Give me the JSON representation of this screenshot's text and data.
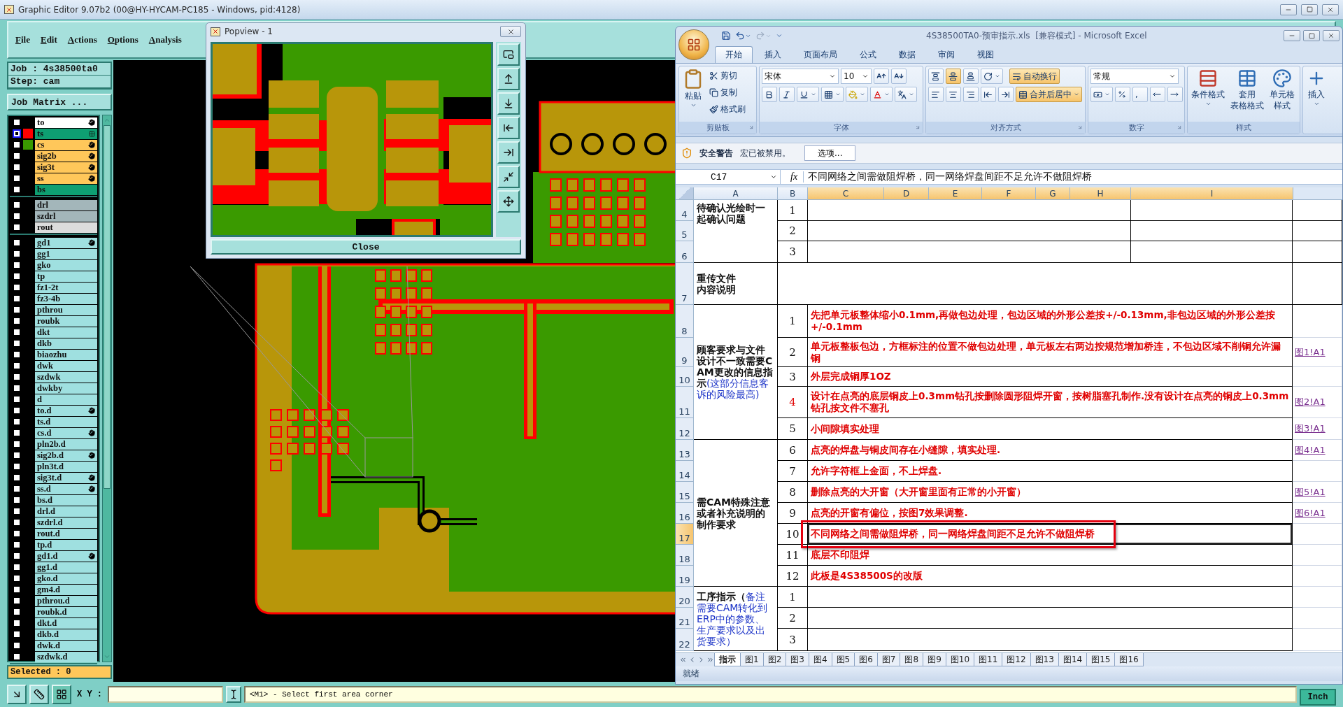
{
  "editor": {
    "title": "Graphic Editor 9.07b2 (00@HY-HYCAM-PC185 - Windows, pid:4128)",
    "menu": [
      "File",
      "Edit",
      "Actions",
      "Options",
      "Analysis"
    ],
    "job": "Job : 4s38500ta0",
    "step": "Step: cam",
    "job_matrix": "Job Matrix ...",
    "layer_groups": [
      {
        "layers": [
          {
            "name": "to",
            "kind": "overlay",
            "selected": false,
            "marker": true
          },
          {
            "name": "ts",
            "kind": "mask",
            "selected": true,
            "marker": false,
            "color": "#ff0000"
          },
          {
            "name": "cs",
            "kind": "signal",
            "selected": false,
            "marker": true,
            "color": "#3a9a00"
          },
          {
            "name": "sig2b",
            "kind": "signal",
            "selected": false,
            "marker": true
          },
          {
            "name": "sig3t",
            "kind": "signal",
            "selected": false,
            "marker": true
          },
          {
            "name": "ss",
            "kind": "signal",
            "selected": false,
            "marker": true
          },
          {
            "name": "bs",
            "kind": "mask",
            "selected": false,
            "marker": false
          }
        ]
      },
      {
        "layers": [
          {
            "name": "drl",
            "kind": "drill",
            "selected": false,
            "marker": false
          },
          {
            "name": "szdrl",
            "kind": "drill",
            "selected": false,
            "marker": false
          },
          {
            "name": "rout",
            "kind": "rout",
            "selected": false,
            "marker": false
          }
        ]
      },
      {
        "layers": [
          {
            "name": "gd1",
            "kind": "document",
            "selected": false,
            "marker": true
          },
          {
            "name": "gg1",
            "kind": "document",
            "selected": false,
            "marker": false
          },
          {
            "name": "gko",
            "kind": "document",
            "selected": false,
            "marker": false
          },
          {
            "name": "tp",
            "kind": "document",
            "selected": false,
            "marker": false
          },
          {
            "name": "fz1-2t",
            "kind": "document",
            "selected": false,
            "marker": false
          },
          {
            "name": "fz3-4b",
            "kind": "document",
            "selected": false,
            "marker": false
          },
          {
            "name": "pthrou",
            "kind": "document",
            "selected": false,
            "marker": false
          },
          {
            "name": "roubk",
            "kind": "document",
            "selected": false,
            "marker": false
          },
          {
            "name": "dkt",
            "kind": "document",
            "selected": false,
            "marker": false
          },
          {
            "name": "dkb",
            "kind": "document",
            "selected": false,
            "marker": false
          },
          {
            "name": "biaozhu",
            "kind": "document",
            "selected": false,
            "marker": false
          },
          {
            "name": "dwk",
            "kind": "document",
            "selected": false,
            "marker": false
          },
          {
            "name": "szdwk",
            "kind": "document",
            "selected": false,
            "marker": false
          },
          {
            "name": "dwkby",
            "kind": "document",
            "selected": false,
            "marker": false
          },
          {
            "name": "d",
            "kind": "document",
            "selected": false,
            "marker": false
          },
          {
            "name": "to.d",
            "kind": "document",
            "selected": false,
            "marker": true
          },
          {
            "name": "ts.d",
            "kind": "document",
            "selected": false,
            "marker": false
          },
          {
            "name": "cs.d",
            "kind": "document",
            "selected": false,
            "marker": true
          },
          {
            "name": "pln2b.d",
            "kind": "document",
            "selected": false,
            "marker": false
          },
          {
            "name": "sig2b.d",
            "kind": "document",
            "selected": false,
            "marker": true
          },
          {
            "name": "pln3t.d",
            "kind": "document",
            "selected": false,
            "marker": false
          },
          {
            "name": "sig3t.d",
            "kind": "document",
            "selected": false,
            "marker": true
          },
          {
            "name": "ss.d",
            "kind": "document",
            "selected": false,
            "marker": true
          },
          {
            "name": "bs.d",
            "kind": "document",
            "selected": false,
            "marker": false
          },
          {
            "name": "drl.d",
            "kind": "document",
            "selected": false,
            "marker": false
          },
          {
            "name": "szdrl.d",
            "kind": "document",
            "selected": false,
            "marker": false
          },
          {
            "name": "rout.d",
            "kind": "document",
            "selected": false,
            "marker": false
          },
          {
            "name": "tp.d",
            "kind": "document",
            "selected": false,
            "marker": false
          },
          {
            "name": "gd1.d",
            "kind": "document",
            "selected": false,
            "marker": true
          },
          {
            "name": "gg1.d",
            "kind": "document",
            "selected": false,
            "marker": false
          },
          {
            "name": "gko.d",
            "kind": "document",
            "selected": false,
            "marker": false
          },
          {
            "name": "gm4.d",
            "kind": "document",
            "selected": false,
            "marker": false
          },
          {
            "name": "pthrou.d",
            "kind": "document",
            "selected": false,
            "marker": false
          },
          {
            "name": "roubk.d",
            "kind": "document",
            "selected": false,
            "marker": false
          },
          {
            "name": "dkt.d",
            "kind": "document",
            "selected": false,
            "marker": false
          },
          {
            "name": "dkb.d",
            "kind": "document",
            "selected": false,
            "marker": false
          },
          {
            "name": "dwk.d",
            "kind": "document",
            "selected": false,
            "marker": false
          },
          {
            "name": "szdwk.d",
            "kind": "document",
            "selected": false,
            "marker": false
          }
        ]
      }
    ],
    "selected_count": "Selected : 0",
    "xy_label": "X Y :",
    "prompt": "<M1> - Select first area corner",
    "units": "Inch"
  },
  "popview": {
    "title": "Popview - 1",
    "close": "Close"
  },
  "excel": {
    "title": "4S38500TA0-预审指示.xls  [兼容模式] - Microsoft Excel",
    "tabs": [
      {
        "label": "开始",
        "selected": true
      },
      {
        "label": "插入",
        "selected": false
      },
      {
        "label": "页面布局",
        "selected": false
      },
      {
        "label": "公式",
        "selected": false
      },
      {
        "label": "数据",
        "selected": false
      },
      {
        "label": "审阅",
        "selected": false
      },
      {
        "label": "视图",
        "selected": false
      }
    ],
    "clipboard": {
      "paste": "粘贴",
      "cut": "剪切",
      "copy": "复制",
      "painter": "格式刷",
      "label": "剪贴板"
    },
    "font": {
      "name": "宋体",
      "size": "10",
      "label": "字体"
    },
    "alignment": {
      "valign": [
        {
          "selected": false
        },
        {
          "selected": true
        },
        {
          "selected": false
        }
      ],
      "wrap": "自动换行",
      "wrap_on": true,
      "merge": "合并后居中",
      "merge_on": true,
      "label": "对齐方式"
    },
    "number": {
      "format": "常规",
      "comma": ",",
      "label": "数字"
    },
    "styles": {
      "conditional": "条件格式",
      "table": [
        "套用",
        "表格格式"
      ],
      "cell": [
        "单元格",
        "样式"
      ],
      "label": "样式"
    },
    "cells": {
      "insert": "插入"
    },
    "security": {
      "title": "安全警告",
      "message": "宏已被禁用。",
      "button": "选项..."
    },
    "formula": {
      "cell": "C17",
      "fx": "fx",
      "content": "不同网络之间需做阻焊桥，同一网络焊盘间距不足允许不做阻焊桥"
    },
    "columns": [
      {
        "label": "A",
        "selected": false
      },
      {
        "label": "B",
        "selected": false
      },
      {
        "label": "C",
        "selected": true
      },
      {
        "label": "D",
        "selected": true
      },
      {
        "label": "E",
        "selected": true
      },
      {
        "label": "F",
        "selected": true
      },
      {
        "label": "G",
        "selected": true
      },
      {
        "label": "H",
        "selected": true
      },
      {
        "label": "I",
        "selected": true
      }
    ],
    "sections": [
      {
        "label": "待确认光绘时一起确认问题",
        "kind": "pending",
        "rows": [
          {
            "row": "4",
            "num": "1",
            "selected": false,
            "marked": false,
            "emphasis": false
          },
          {
            "row": "5",
            "num": "2",
            "selected": false,
            "marked": false,
            "emphasis": false
          },
          {
            "row": "6",
            "num": "3",
            "selected": false,
            "marked": false,
            "emphasis": false
          }
        ]
      },
      {
        "lines": [
          "重传文件",
          "内容说明"
        ],
        "kind": "note",
        "rows": [
          {
            "row": "7",
            "selected": false,
            "marked": false
          }
        ]
      },
      {
        "label": "顾客要求与文件设计不一致需要CAM更改的信息指示",
        "note": "(这部分信息客诉的风险最高)",
        "kind": "list",
        "rows": [
          {
            "row": "8",
            "num": "1",
            "text": "先把单元板整体缩小0.1mm,再做包边处理，包边区域的外形公差按+/-0.13mm,非包边区域的外形公差按+/-0.1mm",
            "selected": false,
            "marked": false,
            "emphasis": false
          },
          {
            "row": "9",
            "num": "2",
            "text": "单元板整板包边，方框标注的位置不做包边处理，单元板左右两边按规范增加桥连，不包边区域不削铜允许漏铜",
            "link": "图1!A1",
            "selected": false,
            "marked": false,
            "emphasis": false
          },
          {
            "row": "10",
            "num": "3",
            "text": "外层完成铜厚1OZ",
            "selected": false,
            "marked": false,
            "emphasis": false
          },
          {
            "row": "11",
            "num": "4",
            "text": "设计在点亮的底层铜皮上0.3mm钻孔按删除圆形阻焊开窗，按树脂塞孔制作.没有设计在点亮的铜皮上0.3mm钻孔按文件不塞孔",
            "link": "图2!A1",
            "selected": false,
            "marked": false,
            "emphasis": true
          },
          {
            "row": "12",
            "num": "5",
            "text": "小间隙填实处理",
            "link": "图3!A1",
            "selected": false,
            "marked": false,
            "emphasis": false
          }
        ]
      },
      {
        "label": "需CAM特殊注意或者补充说明的制作要求",
        "kind": "list",
        "rows": [
          {
            "row": "13",
            "num": "6",
            "text": "点亮的焊盘与铜皮间存在小缝隙，填实处理.",
            "link": "图4!A1",
            "selected": false,
            "marked": false,
            "emphasis": false
          },
          {
            "row": "14",
            "num": "7",
            "text": "允许字符框上金面，不上焊盘.",
            "selected": false,
            "marked": false,
            "emphasis": false
          },
          {
            "row": "15",
            "num": "8",
            "text": "删除点亮的大开窗（大开窗里面有正常的小开窗）",
            "link": "图5!A1",
            "selected": false,
            "marked": false,
            "emphasis": false
          },
          {
            "row": "16",
            "num": "9",
            "text": "点亮的开窗有偏位，按图7效果调整.",
            "link": "图6!A1",
            "selected": false,
            "marked": false,
            "emphasis": false
          },
          {
            "row": "17",
            "num": "10",
            "text": "不同网络之间需做阻焊桥，同一网络焊盘间距不足允许不做阻焊桥",
            "selected": true,
            "marked": true,
            "emphasis": false
          },
          {
            "row": "18",
            "num": "11",
            "text": "底层不印阻焊",
            "selected": false,
            "marked": false,
            "emphasis": false
          },
          {
            "row": "19",
            "num": "12",
            "text": "此板是4S38500S的改版",
            "selected": false,
            "marked": false,
            "emphasis": false
          }
        ]
      },
      {
        "label": "工序指示（",
        "note": "备注需要CAM转化到ERP中的参数、生产要求以及出货要求）",
        "kind": "list",
        "rows": [
          {
            "row": "20",
            "num": "1",
            "selected": false,
            "marked": false,
            "emphasis": false
          },
          {
            "row": "21",
            "num": "2",
            "selected": false,
            "marked": false,
            "emphasis": false
          },
          {
            "row": "22",
            "num": "3",
            "selected": false,
            "marked": false,
            "emphasis": false
          }
        ]
      }
    ],
    "sheets": [
      {
        "label": "指示",
        "selected": true
      },
      {
        "label": "图1",
        "selected": false
      },
      {
        "label": "图2",
        "selected": false
      },
      {
        "label": "图3",
        "selected": false
      },
      {
        "label": "图4",
        "selected": false
      },
      {
        "label": "图5",
        "selected": false
      },
      {
        "label": "图6",
        "selected": false
      },
      {
        "label": "图7",
        "selected": false
      },
      {
        "label": "图8",
        "selected": false
      },
      {
        "label": "图9",
        "selected": false
      },
      {
        "label": "图10",
        "selected": false
      },
      {
        "label": "图11",
        "selected": false
      },
      {
        "label": "图12",
        "selected": false
      },
      {
        "label": "图13",
        "selected": false
      },
      {
        "label": "图14",
        "selected": false
      },
      {
        "label": "图15",
        "selected": false
      },
      {
        "label": "图16",
        "selected": false
      }
    ],
    "status": "就绪"
  }
}
